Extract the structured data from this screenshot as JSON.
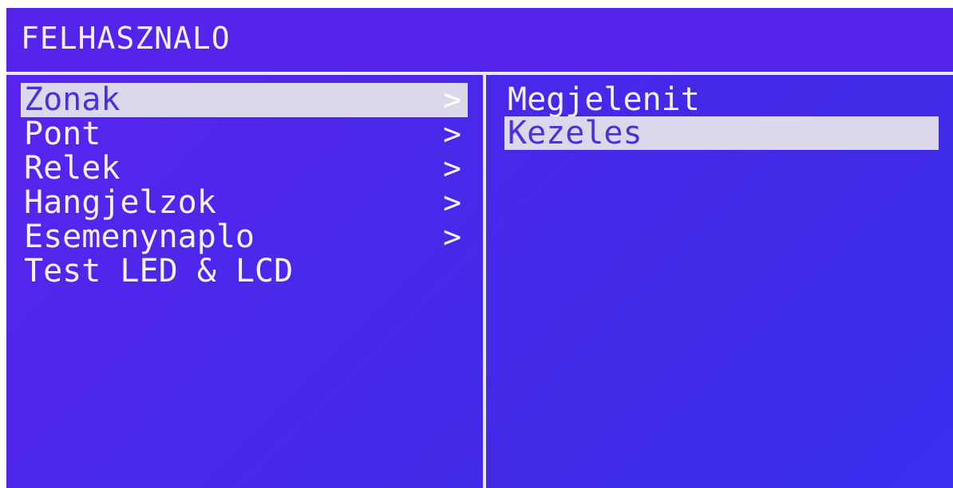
{
  "header": {
    "title": "FELHASZNALO"
  },
  "left_menu": {
    "items": [
      {
        "label": "Zonak",
        "has_submenu": true,
        "selected": true
      },
      {
        "label": "Pont",
        "has_submenu": true,
        "selected": false
      },
      {
        "label": "Relek",
        "has_submenu": true,
        "selected": false
      },
      {
        "label": "Hangjelzok",
        "has_submenu": true,
        "selected": false
      },
      {
        "label": "Esemenynaplo",
        "has_submenu": true,
        "selected": false
      },
      {
        "label": "Test LED & LCD",
        "has_submenu": false,
        "selected": false
      }
    ],
    "chevron_glyph": ">",
    "chevron_icon": "chevron-right-icon"
  },
  "right_menu": {
    "items": [
      {
        "label": "Megjelenit",
        "selected": false
      },
      {
        "label": "Kezeles",
        "selected": true
      }
    ]
  },
  "colors": {
    "screen_background": "#4a28ea",
    "text": "#f4f2ff",
    "highlight": "#dcd8ec"
  }
}
